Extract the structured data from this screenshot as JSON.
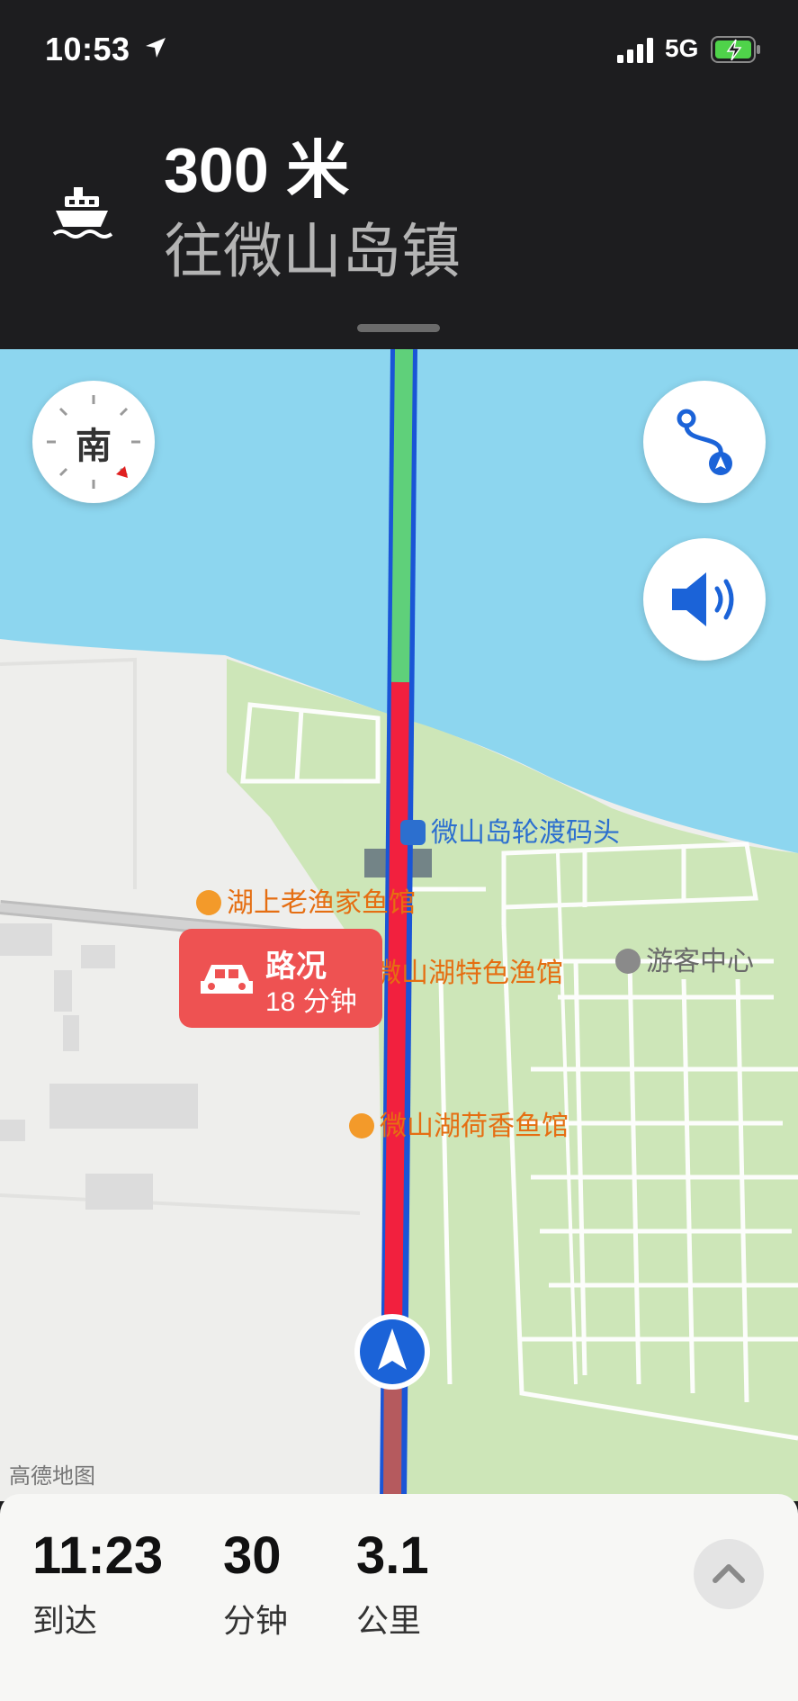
{
  "status_bar": {
    "time": "10:53",
    "network": "5G"
  },
  "navigation": {
    "distance": "300 米",
    "road": "往微山岛镇",
    "maneuver_icon": "ferry-icon"
  },
  "compass": {
    "label": "南"
  },
  "map": {
    "pois": [
      {
        "name": "微山岛轮渡码头",
        "type": "ferry-terminal"
      },
      {
        "name": "湖上老渔家鱼馆",
        "type": "restaurant"
      },
      {
        "name": "游客中心",
        "type": "info"
      },
      {
        "name": "微山湖特色渔馆",
        "type": "restaurant"
      },
      {
        "name": "微山湖荷香鱼馆",
        "type": "restaurant"
      }
    ],
    "traffic_callout": {
      "title": "路况",
      "duration": "18 分钟"
    },
    "brand": "高德地图"
  },
  "summary": {
    "arrival_time": "11:23",
    "arrival_label": "到达",
    "duration": "30",
    "duration_label": "分钟",
    "distance": "3.1",
    "distance_label": "公里"
  },
  "colors": {
    "water": "#8dd6ef",
    "land": "#eeeeec",
    "green_area": "#cde6b8",
    "route_red": "#f2203e",
    "route_green": "#5fd07a",
    "route_blue_edge": "#1a55d6",
    "accent_blue": "#1b63d8"
  }
}
